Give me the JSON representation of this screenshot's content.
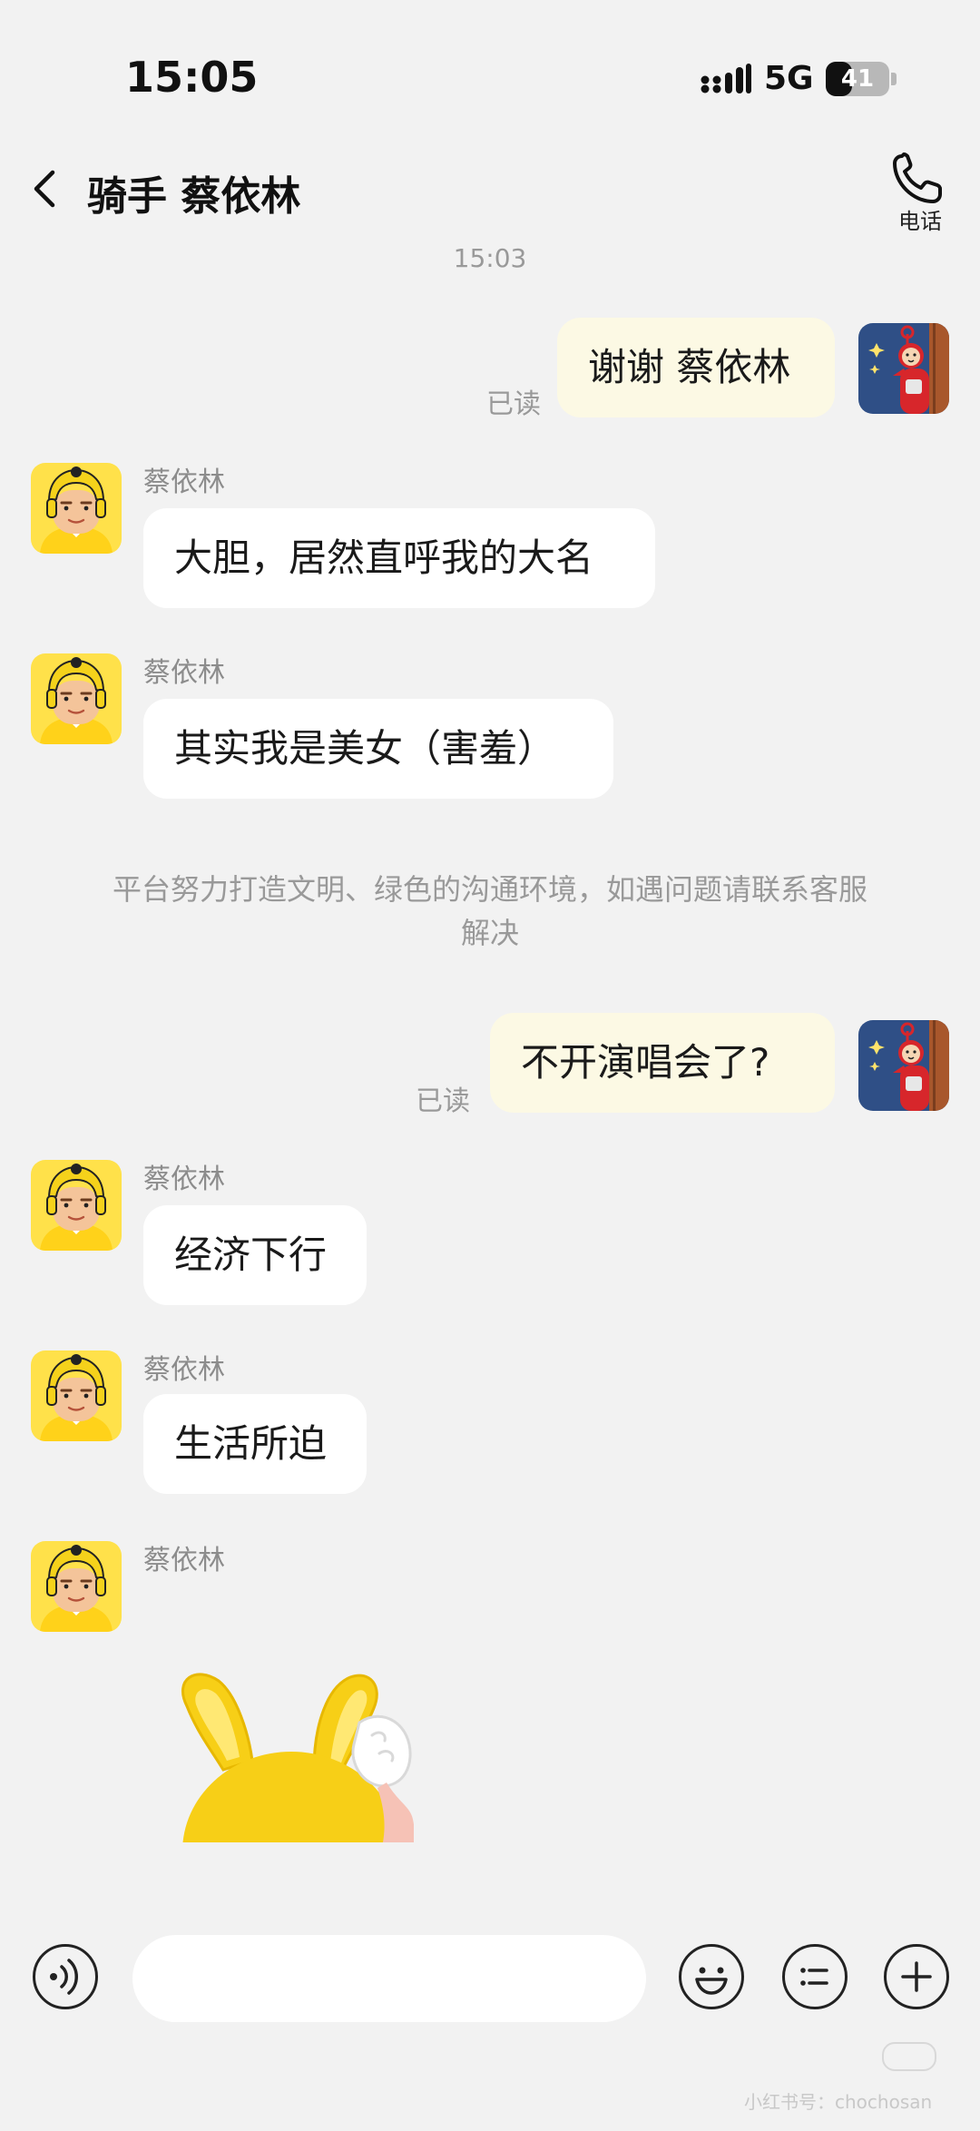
{
  "status_bar": {
    "time": "15:05",
    "network": "5G",
    "battery": "41",
    "battery_level": 0.41
  },
  "header": {
    "title": "骑手 蔡依林",
    "phone_label": "电话"
  },
  "chat": {
    "timestamp": "15:03",
    "sent": [
      {
        "text": "谢谢 蔡依林",
        "status": "已读"
      },
      {
        "text": "不开演唱会了?",
        "status": "已读"
      }
    ],
    "received": [
      {
        "sender": "蔡依林",
        "text": "大胆，居然直呼我的大名"
      },
      {
        "sender": "蔡依林",
        "text": "其实我是美女（害羞）"
      },
      {
        "sender": "蔡依林",
        "text": "经济下行"
      },
      {
        "sender": "蔡依林",
        "text": "生活所迫"
      },
      {
        "sender": "蔡依林",
        "sticker": "yellow-bunny-sticker"
      }
    ],
    "notice": "平台努力打造文明、绿色的沟通环境，如遇问题请联系客服解决"
  },
  "input_bar": {
    "placeholder": "",
    "icons": [
      "voice-icon",
      "emoji-icon",
      "quick-reply-icon",
      "plus-icon"
    ]
  },
  "watermark": "小红书号：chochosan",
  "colors": {
    "background": "#f2f2f2",
    "incoming_bubble": "#ffffff",
    "outgoing_bubble": "#fcf9e4",
    "rider_avatar": "#ffe14a",
    "user_avatar": "#2f4f86"
  }
}
